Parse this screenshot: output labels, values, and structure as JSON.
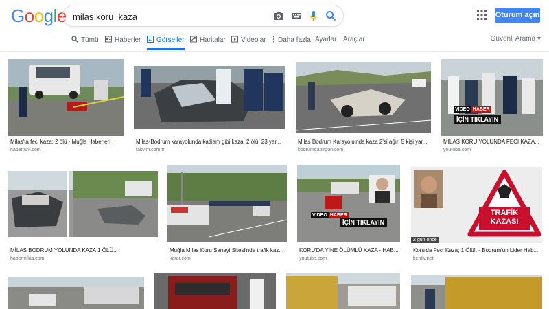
{
  "logo": [
    "G",
    "o",
    "o",
    "g",
    "l",
    "e"
  ],
  "search": {
    "query": "milas koru  kaza"
  },
  "header": {
    "signin_label": "Oturum açın"
  },
  "tabs": [
    {
      "label": "Tümü"
    },
    {
      "label": "Haberler"
    },
    {
      "label": "Görseller"
    },
    {
      "label": "Haritalar"
    },
    {
      "label": "Videolar"
    },
    {
      "label": "Daha fazla"
    },
    {
      "label": "Ayarlar"
    },
    {
      "label": "Araçlar"
    }
  ],
  "safe_search": "Güvenli Arama ▾",
  "results": [
    {
      "caption": "Milas'ta feci kaza: 2 ölü - Muğla Haberleri",
      "source": "haberturk.com"
    },
    {
      "caption": "Milas-Bodrum karayolunda katliam gibi kaza: 2 ölü, 23 yar...",
      "source": "takvim.com.tr"
    },
    {
      "caption": "Milas Bodrum Karayolu'nda kaza 2'si ağır, 5 kişi yar...",
      "source": "bodrumdabirgun.com"
    },
    {
      "caption": "MİLAS KORU YOLUNDA FECİ KAZA...",
      "source": "youtube.com",
      "overlay": {
        "video": "VIDEO",
        "haber": "HABER",
        "click": "İÇİN TIKLAYIN"
      }
    },
    {
      "caption": "MİLAS BODRUM YOLUNDA KAZA 1 ÖLÜ...",
      "source": "habermilas.com"
    },
    {
      "caption": "Muğla Milas Koru Sanayi Sitesi'nde trafik kaz...",
      "source": "karar.com"
    },
    {
      "caption": "KORU'DA YİNE ÖLÜMLÜ KAZA - HAB...",
      "source": "youtube.com",
      "overlay": {
        "video": "VIDEO",
        "haber": "HABER",
        "click": "İÇİN TIKLAYIN"
      }
    },
    {
      "caption": "Koru'da Feci Kaza; 1 Ölü!. - Bodrum'un Lider Hab...",
      "source": "kentlv.net",
      "badge": "2 gün önce",
      "sign_line1": "TRAFİK",
      "sign_line2": "KAZASI"
    },
    {},
    {},
    {},
    {}
  ]
}
